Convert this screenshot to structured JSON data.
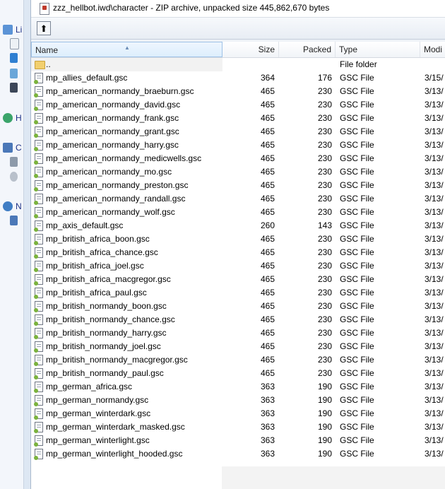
{
  "window": {
    "title": "zzz_hellbot.iwd\\character - ZIP archive, unpacked size 445,862,670 bytes"
  },
  "left_panel": {
    "labels": [
      "Li",
      "H",
      "C",
      "N"
    ]
  },
  "columns": {
    "name": "Name",
    "size": "Size",
    "packed": "Packed",
    "type": "Type",
    "modified": "Modi"
  },
  "rows": [
    {
      "name": "..",
      "size": "",
      "packed": "",
      "type": "File folder",
      "modified": "",
      "icon": "folder-icon"
    },
    {
      "name": "mp_allies_default.gsc",
      "size": "364",
      "packed": "176",
      "type": "GSC File",
      "modified": "3/15/",
      "icon": "gsc-file-icon"
    },
    {
      "name": "mp_american_normandy_braeburn.gsc",
      "size": "465",
      "packed": "230",
      "type": "GSC File",
      "modified": "3/13/",
      "icon": "gsc-file-icon"
    },
    {
      "name": "mp_american_normandy_david.gsc",
      "size": "465",
      "packed": "230",
      "type": "GSC File",
      "modified": "3/13/",
      "icon": "gsc-file-icon"
    },
    {
      "name": "mp_american_normandy_frank.gsc",
      "size": "465",
      "packed": "230",
      "type": "GSC File",
      "modified": "3/13/",
      "icon": "gsc-file-icon"
    },
    {
      "name": "mp_american_normandy_grant.gsc",
      "size": "465",
      "packed": "230",
      "type": "GSC File",
      "modified": "3/13/",
      "icon": "gsc-file-icon"
    },
    {
      "name": "mp_american_normandy_harry.gsc",
      "size": "465",
      "packed": "230",
      "type": "GSC File",
      "modified": "3/13/",
      "icon": "gsc-file-icon"
    },
    {
      "name": "mp_american_normandy_medicwells.gsc",
      "size": "465",
      "packed": "230",
      "type": "GSC File",
      "modified": "3/13/",
      "icon": "gsc-file-icon"
    },
    {
      "name": "mp_american_normandy_mo.gsc",
      "size": "465",
      "packed": "230",
      "type": "GSC File",
      "modified": "3/13/",
      "icon": "gsc-file-icon"
    },
    {
      "name": "mp_american_normandy_preston.gsc",
      "size": "465",
      "packed": "230",
      "type": "GSC File",
      "modified": "3/13/",
      "icon": "gsc-file-icon"
    },
    {
      "name": "mp_american_normandy_randall.gsc",
      "size": "465",
      "packed": "230",
      "type": "GSC File",
      "modified": "3/13/",
      "icon": "gsc-file-icon"
    },
    {
      "name": "mp_american_normandy_wolf.gsc",
      "size": "465",
      "packed": "230",
      "type": "GSC File",
      "modified": "3/13/",
      "icon": "gsc-file-icon"
    },
    {
      "name": "mp_axis_default.gsc",
      "size": "260",
      "packed": "143",
      "type": "GSC File",
      "modified": "3/13/",
      "icon": "gsc-file-icon"
    },
    {
      "name": "mp_british_africa_boon.gsc",
      "size": "465",
      "packed": "230",
      "type": "GSC File",
      "modified": "3/13/",
      "icon": "gsc-file-icon"
    },
    {
      "name": "mp_british_africa_chance.gsc",
      "size": "465",
      "packed": "230",
      "type": "GSC File",
      "modified": "3/13/",
      "icon": "gsc-file-icon"
    },
    {
      "name": "mp_british_africa_joel.gsc",
      "size": "465",
      "packed": "230",
      "type": "GSC File",
      "modified": "3/13/",
      "icon": "gsc-file-icon"
    },
    {
      "name": "mp_british_africa_macgregor.gsc",
      "size": "465",
      "packed": "230",
      "type": "GSC File",
      "modified": "3/13/",
      "icon": "gsc-file-icon"
    },
    {
      "name": "mp_british_africa_paul.gsc",
      "size": "465",
      "packed": "230",
      "type": "GSC File",
      "modified": "3/13/",
      "icon": "gsc-file-icon"
    },
    {
      "name": "mp_british_normandy_boon.gsc",
      "size": "465",
      "packed": "230",
      "type": "GSC File",
      "modified": "3/13/",
      "icon": "gsc-file-icon"
    },
    {
      "name": "mp_british_normandy_chance.gsc",
      "size": "465",
      "packed": "230",
      "type": "GSC File",
      "modified": "3/13/",
      "icon": "gsc-file-icon"
    },
    {
      "name": "mp_british_normandy_harry.gsc",
      "size": "465",
      "packed": "230",
      "type": "GSC File",
      "modified": "3/13/",
      "icon": "gsc-file-icon"
    },
    {
      "name": "mp_british_normandy_joel.gsc",
      "size": "465",
      "packed": "230",
      "type": "GSC File",
      "modified": "3/13/",
      "icon": "gsc-file-icon"
    },
    {
      "name": "mp_british_normandy_macgregor.gsc",
      "size": "465",
      "packed": "230",
      "type": "GSC File",
      "modified": "3/13/",
      "icon": "gsc-file-icon"
    },
    {
      "name": "mp_british_normandy_paul.gsc",
      "size": "465",
      "packed": "230",
      "type": "GSC File",
      "modified": "3/13/",
      "icon": "gsc-file-icon"
    },
    {
      "name": "mp_german_africa.gsc",
      "size": "363",
      "packed": "190",
      "type": "GSC File",
      "modified": "3/13/",
      "icon": "gsc-file-icon"
    },
    {
      "name": "mp_german_normandy.gsc",
      "size": "363",
      "packed": "190",
      "type": "GSC File",
      "modified": "3/13/",
      "icon": "gsc-file-icon"
    },
    {
      "name": "mp_german_winterdark.gsc",
      "size": "363",
      "packed": "190",
      "type": "GSC File",
      "modified": "3/13/",
      "icon": "gsc-file-icon"
    },
    {
      "name": "mp_german_winterdark_masked.gsc",
      "size": "363",
      "packed": "190",
      "type": "GSC File",
      "modified": "3/13/",
      "icon": "gsc-file-icon"
    },
    {
      "name": "mp_german_winterlight.gsc",
      "size": "363",
      "packed": "190",
      "type": "GSC File",
      "modified": "3/13/",
      "icon": "gsc-file-icon"
    },
    {
      "name": "mp_german_winterlight_hooded.gsc",
      "size": "363",
      "packed": "190",
      "type": "GSC File",
      "modified": "3/13/",
      "icon": "gsc-file-icon"
    }
  ]
}
